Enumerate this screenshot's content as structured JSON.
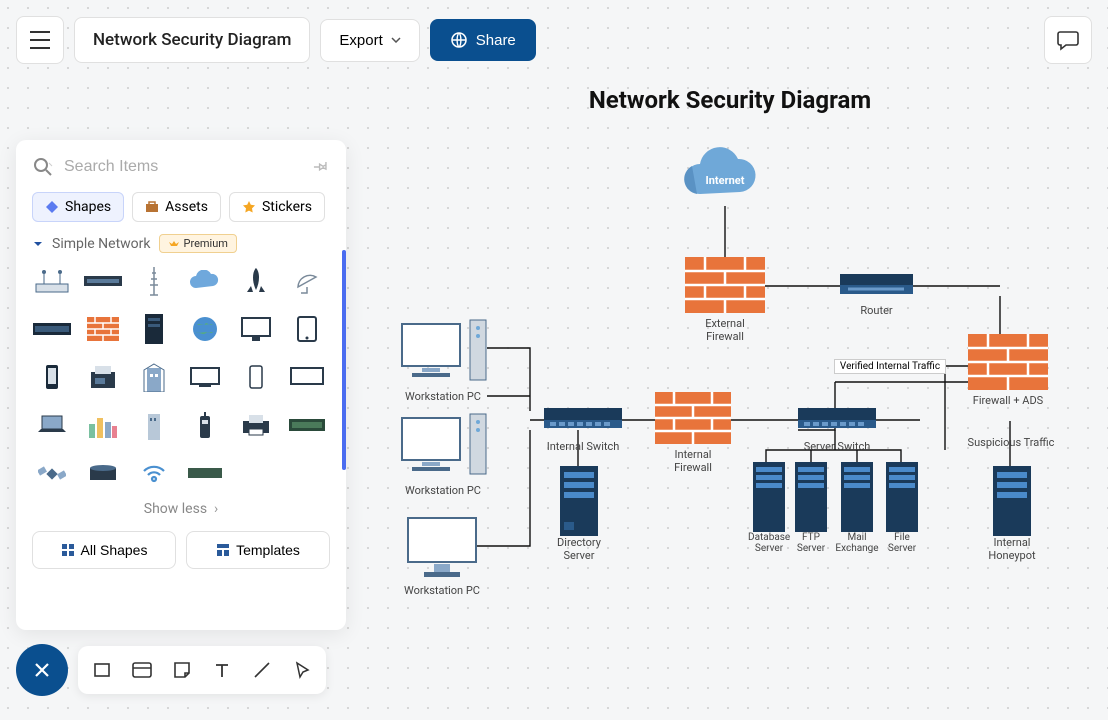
{
  "header": {
    "title": "Network Security Diagram",
    "export_label": "Export",
    "share_label": "Share"
  },
  "sidebar": {
    "search_placeholder": "Search Items",
    "tabs": [
      {
        "label": "Shapes",
        "icon": "diamond"
      },
      {
        "label": "Assets",
        "icon": "briefcase"
      },
      {
        "label": "Stickers",
        "icon": "star"
      }
    ],
    "category": {
      "name": "Simple Network",
      "premium_label": "Premium"
    },
    "shapes": [
      "wifi-router",
      "rack-switch-1",
      "antenna-tower",
      "cloud",
      "rocket",
      "satellite-dish",
      "rack-switch-2",
      "brick-firewall",
      "server-tower",
      "globe",
      "desktop-monitor",
      "tablet",
      "smartphone",
      "fax-machine",
      "building",
      "flat-monitor",
      "phone-portrait",
      "widescreen",
      "laptop",
      "cityscape",
      "office-tower",
      "cordless-phone",
      "printer",
      "rack-unit",
      "satellite-small",
      "disk-drive",
      "wifi-signal",
      "small-switch"
    ],
    "show_less_label": "Show less",
    "all_shapes_label": "All Shapes",
    "templates_label": "Templates"
  },
  "diagram": {
    "title": "Network Security Diagram",
    "nodes": {
      "internet": "Internet",
      "external_firewall": "External Firewall",
      "router": "Router",
      "workstation1": "Workstation PC",
      "workstation2": "Workstation PC",
      "workstation3": "Workstation PC",
      "internal_switch": "Internal Switch",
      "internal_firewall": "Internal Firewall",
      "directory_server": "Directory Server",
      "server_switch": "Server Switch",
      "database_server": "Database Server",
      "ftp_server": "FTP Server",
      "mail_exchange": "Mail Exchange",
      "file_server": "File Server",
      "firewall_ads": "Firewall + ADS",
      "internal_honeypot": "Internal Honeypot",
      "verified_internal": "Verified Internal Traffic",
      "suspicious_traffic": "Suspicious Traffic"
    }
  },
  "tools": [
    "rectangle",
    "card",
    "note",
    "text",
    "line",
    "pointer"
  ]
}
